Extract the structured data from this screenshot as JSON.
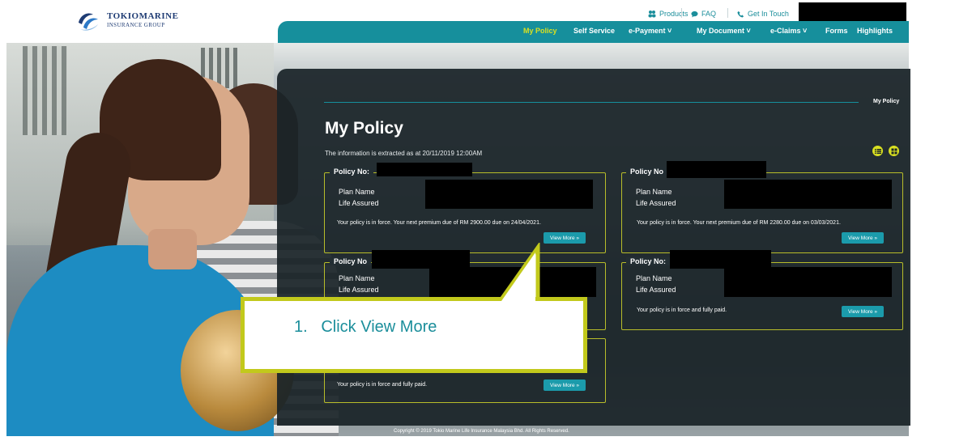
{
  "header": {
    "brand_name": "TOKIOMARINE",
    "brand_sub": "INSURANCE GROUP",
    "utility_links": [
      "Products",
      "FAQ",
      "Get In Touch"
    ],
    "nav": [
      {
        "label": "My Policy",
        "active": true
      },
      {
        "label": "Self Service"
      },
      {
        "label": "e-Payment ˅"
      },
      {
        "label": "My Document ˅"
      },
      {
        "label": "e-Claims ˅"
      },
      {
        "label": "Forms"
      },
      {
        "label": "Highlights"
      }
    ]
  },
  "main": {
    "breadcrumb": "My Policy",
    "title": "My Policy",
    "info": "The information is extracted as at 20/11/2019 12:00AM",
    "view_toggle_icons": [
      "list-view-icon",
      "grid-view-icon"
    ],
    "plan_name_label": "Plan Name",
    "life_assured_label": "Life Assured",
    "view_more_label": "View More  »",
    "policies": [
      {
        "title": "Policy No:",
        "status": "Your policy is in force. Your next premium due of RM 2900.00 due on 24/04/2021."
      },
      {
        "title": "Policy No",
        "status": "Your policy is in force. Your next premium due of RM 2280.00 due on 03/03/2021."
      },
      {
        "title": "Policy No",
        "status": ""
      },
      {
        "title": "Policy No:",
        "status": "Your policy is in force and fully paid."
      },
      {
        "title": "",
        "status": "Your policy is in force and fully paid."
      }
    ]
  },
  "footer": {
    "copyright": "Copyright © 2019 Tokio Marine Life Insurance Malaysia Bhd. All Rights Reserved."
  },
  "callout": {
    "text": "1.   Click View More"
  },
  "colors": {
    "teal": "#168f9c",
    "accent": "#d9e021",
    "panel": "#1a2428",
    "callout_border": "#c2c91c"
  }
}
